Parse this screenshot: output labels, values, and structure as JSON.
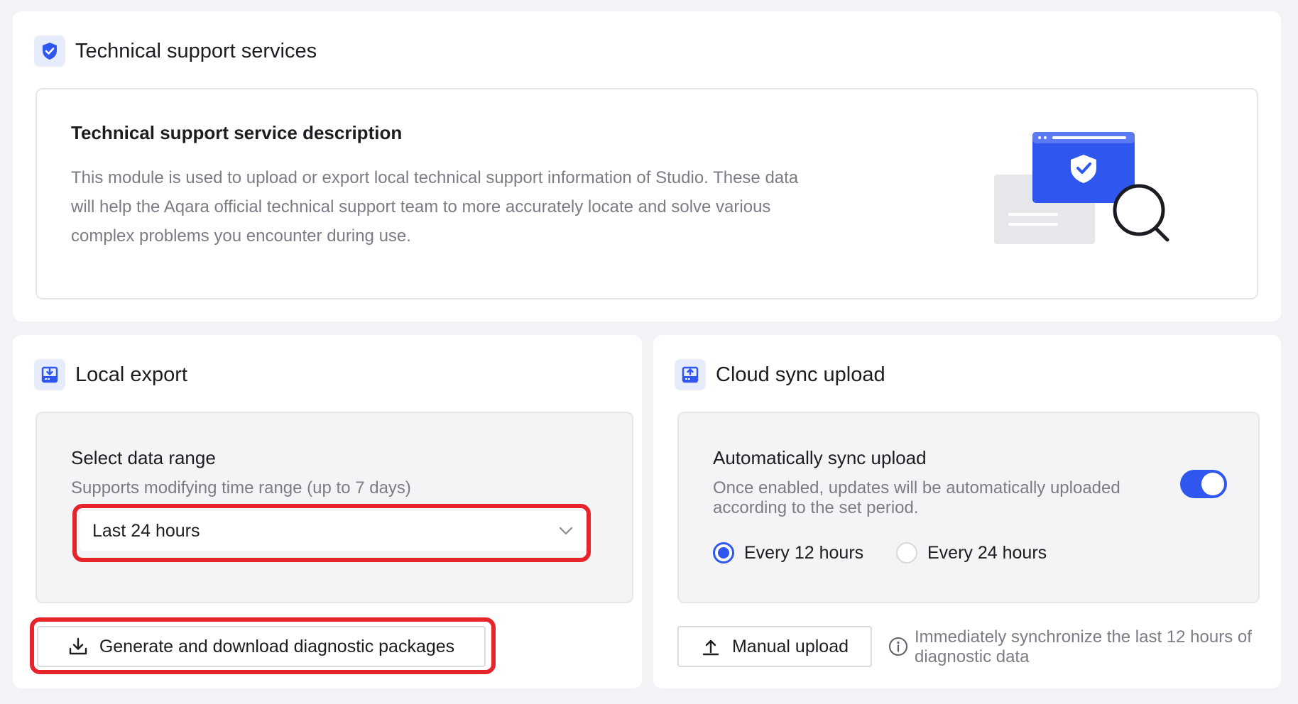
{
  "support": {
    "title": "Technical support services",
    "icon": "shield-check-icon",
    "desc_title": "Technical support service description",
    "desc_body": "This module is used to upload or export local technical support information of Studio. These data will help the Aqara official technical support team to more accurately locate and solve various complex problems you encounter during use.",
    "illustration": "browser-shield-magnifier-illustration"
  },
  "local_export": {
    "title": "Local export",
    "icon": "download-box-icon",
    "range_title": "Select data range",
    "range_subtitle": "Supports modifying time range (up to 7 days)",
    "range_value": "Last 24 hours",
    "generate_button": "Generate and download diagnostic packages"
  },
  "cloud_sync": {
    "title": "Cloud sync upload",
    "icon": "upload-box-icon",
    "auto_title": "Automatically sync upload",
    "auto_subtitle": "Once enabled, updates will be automatically uploaded according to the set period.",
    "auto_enabled": true,
    "periods": [
      {
        "label": "Every 12 hours",
        "selected": true
      },
      {
        "label": "Every 24 hours",
        "selected": false
      }
    ],
    "manual_button": "Manual upload",
    "manual_hint": "Immediately synchronize the last 12 hours of diagnostic data"
  },
  "colors": {
    "accent": "#2f57f0",
    "highlight": "#e8242b"
  }
}
